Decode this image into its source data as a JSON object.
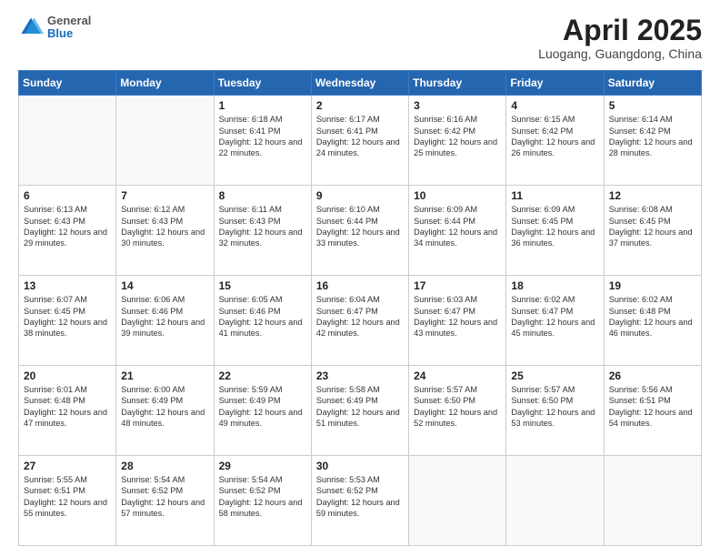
{
  "header": {
    "logo_general": "General",
    "logo_blue": "Blue",
    "title": "April 2025",
    "location": "Luogang, Guangdong, China"
  },
  "weekdays": [
    "Sunday",
    "Monday",
    "Tuesday",
    "Wednesday",
    "Thursday",
    "Friday",
    "Saturday"
  ],
  "weeks": [
    [
      {
        "day": "",
        "sunrise": "",
        "sunset": "",
        "daylight": ""
      },
      {
        "day": "",
        "sunrise": "",
        "sunset": "",
        "daylight": ""
      },
      {
        "day": "1",
        "sunrise": "Sunrise: 6:18 AM",
        "sunset": "Sunset: 6:41 PM",
        "daylight": "Daylight: 12 hours and 22 minutes."
      },
      {
        "day": "2",
        "sunrise": "Sunrise: 6:17 AM",
        "sunset": "Sunset: 6:41 PM",
        "daylight": "Daylight: 12 hours and 24 minutes."
      },
      {
        "day": "3",
        "sunrise": "Sunrise: 6:16 AM",
        "sunset": "Sunset: 6:42 PM",
        "daylight": "Daylight: 12 hours and 25 minutes."
      },
      {
        "day": "4",
        "sunrise": "Sunrise: 6:15 AM",
        "sunset": "Sunset: 6:42 PM",
        "daylight": "Daylight: 12 hours and 26 minutes."
      },
      {
        "day": "5",
        "sunrise": "Sunrise: 6:14 AM",
        "sunset": "Sunset: 6:42 PM",
        "daylight": "Daylight: 12 hours and 28 minutes."
      }
    ],
    [
      {
        "day": "6",
        "sunrise": "Sunrise: 6:13 AM",
        "sunset": "Sunset: 6:43 PM",
        "daylight": "Daylight: 12 hours and 29 minutes."
      },
      {
        "day": "7",
        "sunrise": "Sunrise: 6:12 AM",
        "sunset": "Sunset: 6:43 PM",
        "daylight": "Daylight: 12 hours and 30 minutes."
      },
      {
        "day": "8",
        "sunrise": "Sunrise: 6:11 AM",
        "sunset": "Sunset: 6:43 PM",
        "daylight": "Daylight: 12 hours and 32 minutes."
      },
      {
        "day": "9",
        "sunrise": "Sunrise: 6:10 AM",
        "sunset": "Sunset: 6:44 PM",
        "daylight": "Daylight: 12 hours and 33 minutes."
      },
      {
        "day": "10",
        "sunrise": "Sunrise: 6:09 AM",
        "sunset": "Sunset: 6:44 PM",
        "daylight": "Daylight: 12 hours and 34 minutes."
      },
      {
        "day": "11",
        "sunrise": "Sunrise: 6:09 AM",
        "sunset": "Sunset: 6:45 PM",
        "daylight": "Daylight: 12 hours and 36 minutes."
      },
      {
        "day": "12",
        "sunrise": "Sunrise: 6:08 AM",
        "sunset": "Sunset: 6:45 PM",
        "daylight": "Daylight: 12 hours and 37 minutes."
      }
    ],
    [
      {
        "day": "13",
        "sunrise": "Sunrise: 6:07 AM",
        "sunset": "Sunset: 6:45 PM",
        "daylight": "Daylight: 12 hours and 38 minutes."
      },
      {
        "day": "14",
        "sunrise": "Sunrise: 6:06 AM",
        "sunset": "Sunset: 6:46 PM",
        "daylight": "Daylight: 12 hours and 39 minutes."
      },
      {
        "day": "15",
        "sunrise": "Sunrise: 6:05 AM",
        "sunset": "Sunset: 6:46 PM",
        "daylight": "Daylight: 12 hours and 41 minutes."
      },
      {
        "day": "16",
        "sunrise": "Sunrise: 6:04 AM",
        "sunset": "Sunset: 6:47 PM",
        "daylight": "Daylight: 12 hours and 42 minutes."
      },
      {
        "day": "17",
        "sunrise": "Sunrise: 6:03 AM",
        "sunset": "Sunset: 6:47 PM",
        "daylight": "Daylight: 12 hours and 43 minutes."
      },
      {
        "day": "18",
        "sunrise": "Sunrise: 6:02 AM",
        "sunset": "Sunset: 6:47 PM",
        "daylight": "Daylight: 12 hours and 45 minutes."
      },
      {
        "day": "19",
        "sunrise": "Sunrise: 6:02 AM",
        "sunset": "Sunset: 6:48 PM",
        "daylight": "Daylight: 12 hours and 46 minutes."
      }
    ],
    [
      {
        "day": "20",
        "sunrise": "Sunrise: 6:01 AM",
        "sunset": "Sunset: 6:48 PM",
        "daylight": "Daylight: 12 hours and 47 minutes."
      },
      {
        "day": "21",
        "sunrise": "Sunrise: 6:00 AM",
        "sunset": "Sunset: 6:49 PM",
        "daylight": "Daylight: 12 hours and 48 minutes."
      },
      {
        "day": "22",
        "sunrise": "Sunrise: 5:59 AM",
        "sunset": "Sunset: 6:49 PM",
        "daylight": "Daylight: 12 hours and 49 minutes."
      },
      {
        "day": "23",
        "sunrise": "Sunrise: 5:58 AM",
        "sunset": "Sunset: 6:49 PM",
        "daylight": "Daylight: 12 hours and 51 minutes."
      },
      {
        "day": "24",
        "sunrise": "Sunrise: 5:57 AM",
        "sunset": "Sunset: 6:50 PM",
        "daylight": "Daylight: 12 hours and 52 minutes."
      },
      {
        "day": "25",
        "sunrise": "Sunrise: 5:57 AM",
        "sunset": "Sunset: 6:50 PM",
        "daylight": "Daylight: 12 hours and 53 minutes."
      },
      {
        "day": "26",
        "sunrise": "Sunrise: 5:56 AM",
        "sunset": "Sunset: 6:51 PM",
        "daylight": "Daylight: 12 hours and 54 minutes."
      }
    ],
    [
      {
        "day": "27",
        "sunrise": "Sunrise: 5:55 AM",
        "sunset": "Sunset: 6:51 PM",
        "daylight": "Daylight: 12 hours and 55 minutes."
      },
      {
        "day": "28",
        "sunrise": "Sunrise: 5:54 AM",
        "sunset": "Sunset: 6:52 PM",
        "daylight": "Daylight: 12 hours and 57 minutes."
      },
      {
        "day": "29",
        "sunrise": "Sunrise: 5:54 AM",
        "sunset": "Sunset: 6:52 PM",
        "daylight": "Daylight: 12 hours and 58 minutes."
      },
      {
        "day": "30",
        "sunrise": "Sunrise: 5:53 AM",
        "sunset": "Sunset: 6:52 PM",
        "daylight": "Daylight: 12 hours and 59 minutes."
      },
      {
        "day": "",
        "sunrise": "",
        "sunset": "",
        "daylight": ""
      },
      {
        "day": "",
        "sunrise": "",
        "sunset": "",
        "daylight": ""
      },
      {
        "day": "",
        "sunrise": "",
        "sunset": "",
        "daylight": ""
      }
    ]
  ]
}
